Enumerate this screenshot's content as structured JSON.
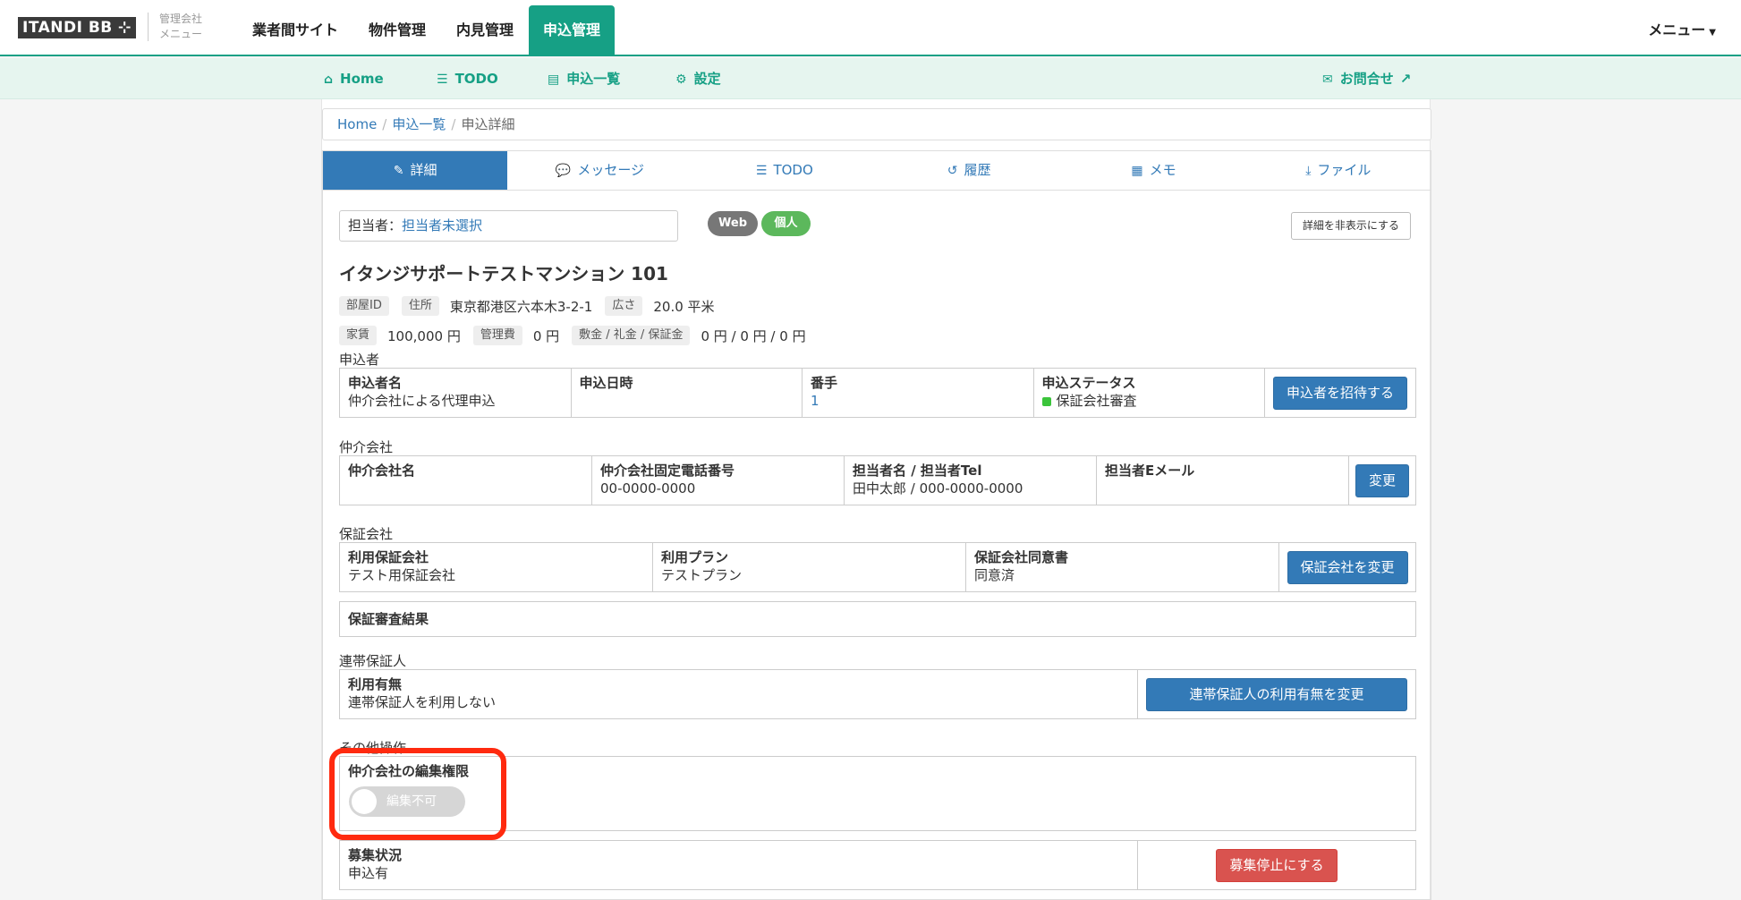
{
  "brand": {
    "logo": "ITANDI BB ⊹",
    "sub_line1": "管理会社",
    "sub_line2": "メニュー"
  },
  "top_nav": {
    "items": [
      "業者間サイト",
      "物件管理",
      "内見管理",
      "申込管理"
    ],
    "active": "申込管理",
    "menu_label": "メニュー"
  },
  "sub_nav": {
    "home": "Home",
    "todo": "TODO",
    "applications": "申込一覧",
    "settings": "設定",
    "contact": "お問合せ"
  },
  "breadcrumb": {
    "home": "Home",
    "list": "申込一覧",
    "current": "申込詳細"
  },
  "tabs": [
    "詳細",
    "メッセージ",
    "TODO",
    "履歴",
    "メモ",
    "ファイル"
  ],
  "assignee": {
    "label": "担当者：",
    "value": "担当者未選択"
  },
  "badges": {
    "web": "Web",
    "individual": "個人"
  },
  "hide_details_button": "詳細を非表示にする",
  "property": {
    "title": "イタンジサポートテストマンション 101",
    "room_id_label": "部屋ID",
    "address_label": "住所",
    "address": "東京都港区六本木3-2-1",
    "area_label": "広さ",
    "area": "20.0 平米",
    "rent_label": "家賃",
    "rent": "100,000 円",
    "mgmt_fee_label": "管理費",
    "mgmt_fee": "0 円",
    "deposit_label": "敷金 / 礼金 / 保証金",
    "deposit": "0 円 / 0 円 / 0 円"
  },
  "applicant": {
    "section": "申込者",
    "name_h": "申込者名",
    "name_v": "仲介会社による代理申込",
    "date_h": "申込日時",
    "date_v": "",
    "order_h": "番手",
    "order_v": "1",
    "status_h": "申込ステータス",
    "status_v": "保証会社審査",
    "invite_button": "申込者を招待する"
  },
  "broker": {
    "section": "仲介会社",
    "name_h": "仲介会社名",
    "name_v": "",
    "phone_h": "仲介会社固定電話番号",
    "phone_v": "00-0000-0000",
    "staff_h": "担当者名 / 担当者Tel",
    "staff_v": "田中太郎 / 000-0000-0000",
    "email_h": "担当者Eメール",
    "email_v": "",
    "change_button": "変更"
  },
  "guarantor_company": {
    "section": "保証会社",
    "company_h": "利用保証会社",
    "company_v": "テスト用保証会社",
    "plan_h": "利用プラン",
    "plan_v": "テストプラン",
    "consent_h": "保証会社同意書",
    "consent_v": "同意済",
    "change_button": "保証会社を変更",
    "result_h": "保証審査結果"
  },
  "joint_guarantor": {
    "section": "連帯保証人",
    "usage_h": "利用有無",
    "usage_v": "連帯保証人を利用しない",
    "change_button": "連帯保証人の利用有無を変更"
  },
  "other": {
    "section": "その他操作",
    "edit_perm_h": "仲介会社の編集権限",
    "toggle_label": "編集不可",
    "toggle_on": false,
    "recruit_h": "募集状況",
    "recruit_v": "申込有",
    "stop_button": "募集停止にする"
  },
  "colors": {
    "brand_green": "#16a085",
    "primary": "#337ab7",
    "danger": "#d9534f",
    "highlight": "#ff2a0f",
    "status_green": "#3bc43b"
  }
}
